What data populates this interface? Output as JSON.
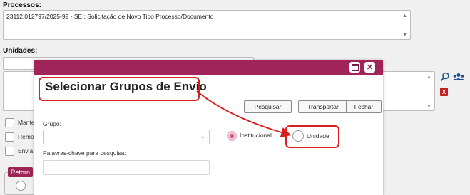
{
  "background": {
    "processos_label": "Processos:",
    "processos_value": "23112.012797/2025-92 - SEI: Solicitação de Novo Tipo Processo/Documento",
    "unidades_label": "Unidades:",
    "checkbox_labels": [
      "Mante",
      "Remo",
      "Envia"
    ],
    "retorno_label": "Retorn"
  },
  "modal": {
    "title": "Selecionar Grupos de Envio",
    "buttons": {
      "pesquisar_first": "P",
      "pesquisar_rest": "esquisar",
      "transportar_first": "T",
      "transportar_rest": "ransportar",
      "fechar_first": "F",
      "fechar_rest": "echar"
    },
    "grupo_label_first": "G",
    "grupo_label_rest": "rupo:",
    "radio_institucional": "Institucional",
    "radio_unidade": "Unidade",
    "keywords_label": "Palavras-chave para pesquisa:"
  },
  "colors": {
    "modal_header": "#a0245a",
    "highlight_red": "#d81f1f",
    "radio_selected": "#c9568a",
    "retorno_bg": "#9c2555"
  }
}
